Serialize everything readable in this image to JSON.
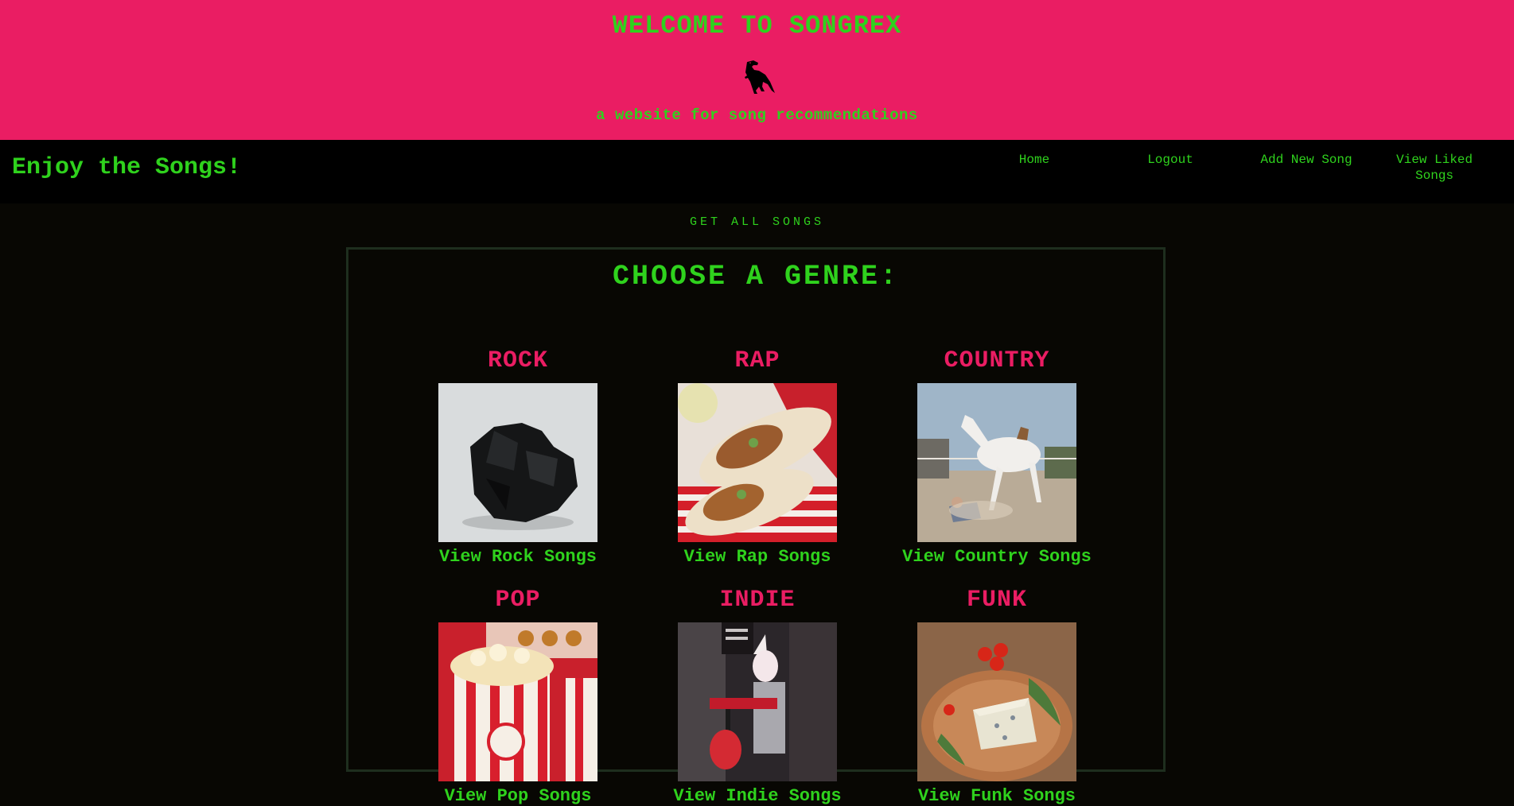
{
  "header": {
    "title": "WELCOME TO SONGREX",
    "subtitle": "a website for song recommendations",
    "logo_icon": "t-rex-icon"
  },
  "nav": {
    "brand": "Enjoy the Songs!",
    "links": [
      "Home",
      "Logout",
      "Add New Song",
      "View Liked Songs"
    ]
  },
  "main": {
    "get_all": "GET ALL SONGS",
    "title": "CHOOSE A GENRE:",
    "genres": [
      {
        "name": "ROCK",
        "link": "View Rock Songs",
        "image": "coal-rock"
      },
      {
        "name": "RAP",
        "link": "View Rap Songs",
        "image": "burrito-wrap"
      },
      {
        "name": "COUNTRY",
        "link": "View Country Songs",
        "image": "rodeo-horse"
      },
      {
        "name": "POP",
        "link": "View Pop Songs",
        "image": "popcorn"
      },
      {
        "name": "INDIE",
        "link": "View Indie Songs",
        "image": "unicorn-keyboard"
      },
      {
        "name": "FUNK",
        "link": "View Funk Songs",
        "image": "cheese-plate"
      }
    ]
  },
  "colors": {
    "pink": "#ea1d63",
    "green": "#2fd21d",
    "background": "#080703",
    "nav": "#000000"
  }
}
